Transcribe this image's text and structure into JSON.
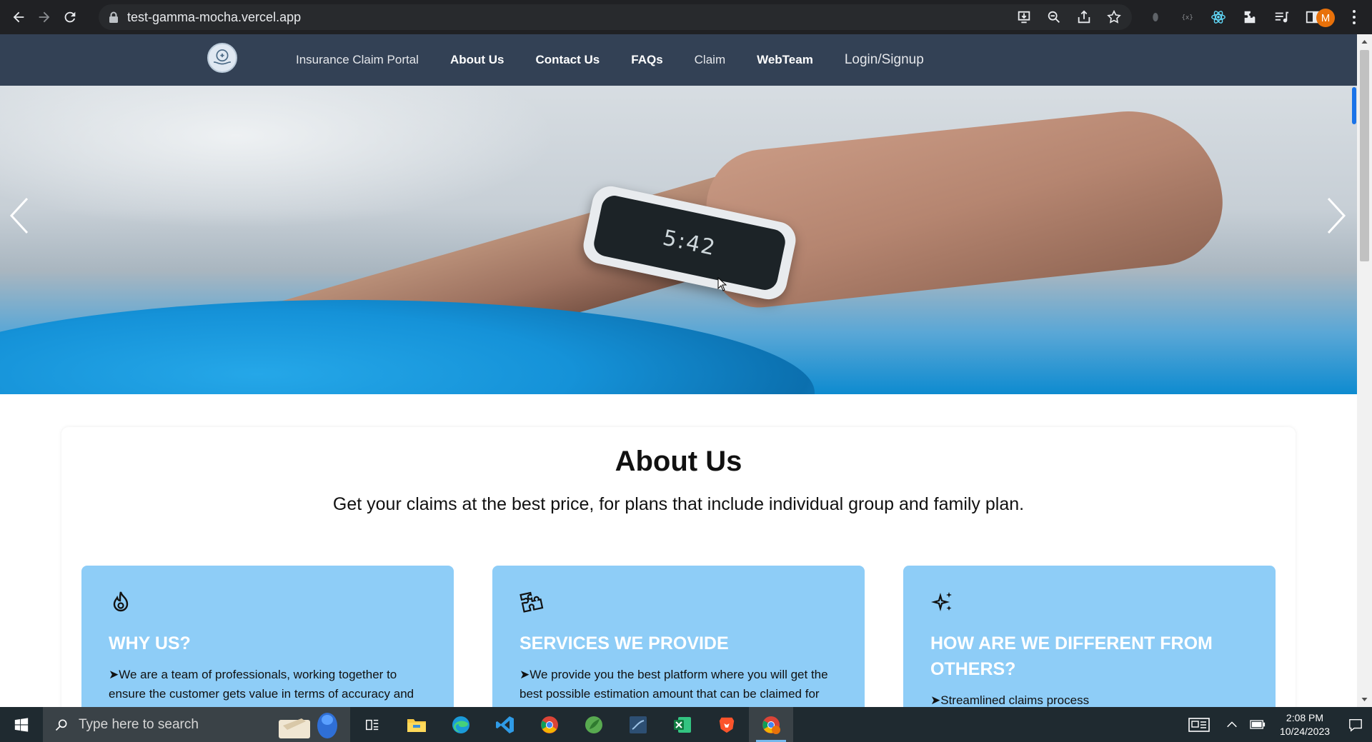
{
  "browser": {
    "url": "test-gamma-mocha.vercel.app",
    "profile_initial": "M"
  },
  "site_nav": {
    "brand": "Insurance Claim Portal",
    "links": [
      "About Us",
      "Contact Us",
      "FAQs",
      "Claim",
      "WebTeam"
    ],
    "login": "Login/Signup"
  },
  "hero": {
    "watch_time": "5:42"
  },
  "about": {
    "title": "About Us",
    "subtitle": "Get your claims at the best price, for plans that include individual group and family plan.",
    "features": [
      {
        "icon": "fire-icon",
        "title": "WHY US?",
        "text": "➤We are a team of professionals, working together to ensure the customer gets value in terms of accuracy and timeliness."
      },
      {
        "icon": "puzzle-icon",
        "title": "SERVICES WE PROVIDE",
        "text": "➤We provide you the best platform where you will get the best possible estimation amount that can be claimed for insurance based on facts."
      },
      {
        "icon": "sparkles-icon",
        "title": "HOW ARE WE DIFFERENT FROM OTHERS?",
        "text": "➤Streamlined claims process"
      }
    ]
  },
  "taskbar": {
    "search_placeholder": "Type here to search",
    "time": "2:08 PM",
    "date": "10/24/2023",
    "apps": [
      "task-view",
      "file-explorer",
      "edge",
      "vscode",
      "chrome",
      "mongodb-compass",
      "mysql-workbench",
      "excel",
      "brave",
      "chrome-profile"
    ]
  }
}
